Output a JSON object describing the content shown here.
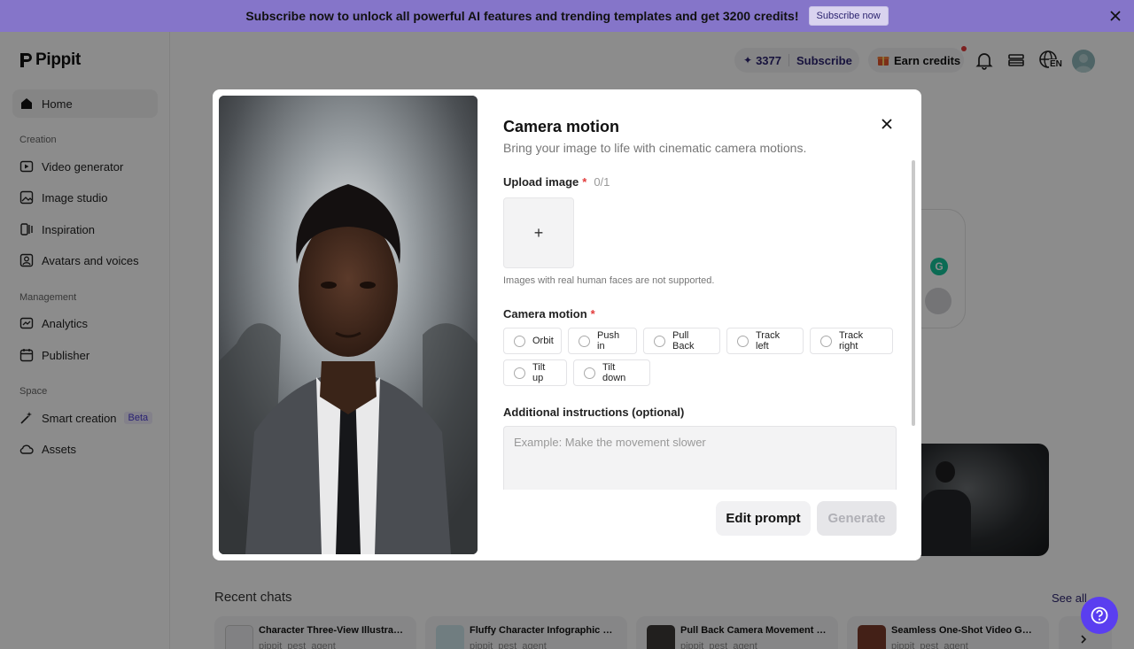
{
  "banner": {
    "text": "Subscribe now to unlock all powerful AI features and trending templates and get 3200 credits!",
    "button": "Subscribe now"
  },
  "logo": {
    "text": "Pippit"
  },
  "sidebar": {
    "home": "Home",
    "sections": {
      "creation": "Creation",
      "management": "Management",
      "space": "Space"
    },
    "items": {
      "video_generator": "Video generator",
      "image_studio": "Image studio",
      "inspiration": "Inspiration",
      "avatars": "Avatars and voices",
      "analytics": "Analytics",
      "publisher": "Publisher",
      "smart_creation": "Smart creation",
      "smart_creation_badge": "Beta",
      "assets": "Assets"
    }
  },
  "header": {
    "credits": "3377",
    "subscribe": "Subscribe",
    "earn_credits": "Earn credits",
    "language": "EN"
  },
  "recent": {
    "title": "Recent chats",
    "see_all": "See all",
    "chats": [
      {
        "title": "Character Three-View Illustra…",
        "sub": "pippit_pest_agent"
      },
      {
        "title": "Fluffy Character Infographic …",
        "sub": "pippit_pest_agent"
      },
      {
        "title": "Pull Back Camera Movement …",
        "sub": "pippit_pest_agent"
      },
      {
        "title": "Seamless One-Shot Video G…",
        "sub": "pippit_pest_agent"
      }
    ]
  },
  "modal": {
    "title": "Camera motion",
    "subtitle": "Bring your image to life with cinematic camera motions.",
    "upload_label": "Upload image",
    "upload_count": "0/1",
    "upload_plus": "+",
    "upload_hint": "Images with real human faces are not supported.",
    "motion_label": "Camera motion",
    "required_mark": "*",
    "options": [
      "Orbit",
      "Push in",
      "Pull Back",
      "Track left",
      "Track right",
      "Tilt up",
      "Tilt down"
    ],
    "instructions_label": "Additional instructions (optional)",
    "instructions_placeholder": "Example: Make the movement slower",
    "edit_prompt": "Edit prompt",
    "generate": "Generate"
  }
}
